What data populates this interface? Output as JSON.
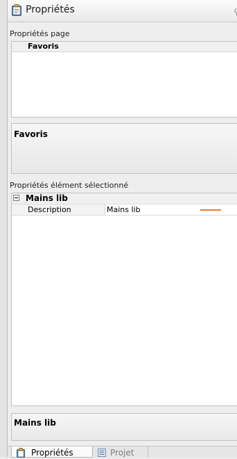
{
  "panel": {
    "title": "Propriétés"
  },
  "page_props": {
    "label": "Propriétés page",
    "header": "Favoris",
    "description_title": "Favoris"
  },
  "element_props": {
    "label": "Propriétés élément sélectionné",
    "category": "Mains lib",
    "rows": [
      {
        "name": "Description",
        "value": "Mains lib"
      }
    ],
    "description_title": "Mains lib"
  },
  "tabs": [
    {
      "label": "Propriétés",
      "active": true,
      "icon": "properties-icon"
    },
    {
      "label": "Projet",
      "active": false,
      "icon": "project-icon"
    }
  ],
  "colors": {
    "accent": "#e87a35"
  }
}
